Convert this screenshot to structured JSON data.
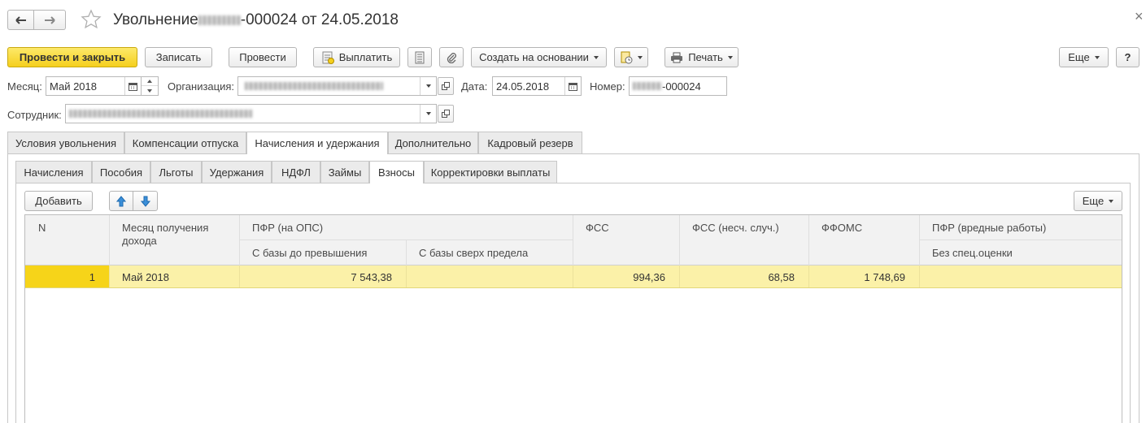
{
  "window": {
    "title_prefix": "Увольнение ",
    "title_suffix": "-000024 от 24.05.2018",
    "close_glyph": "×"
  },
  "toolbar": {
    "post_close": "Провести и закрыть",
    "save": "Записать",
    "post": "Провести",
    "pay": "Выплатить",
    "create_based": "Создать на основании",
    "print": "Печать",
    "more": "Еще",
    "help": "?"
  },
  "form": {
    "month_label": "Месяц:",
    "month_value": "Май 2018",
    "org_label": "Организация:",
    "date_label": "Дата:",
    "date_value": "24.05.2018",
    "number_label": "Номер:",
    "number_suffix": "-000024",
    "employee_label": "Сотрудник:"
  },
  "tabs_main": [
    "Условия увольнения",
    "Компенсации отпуска",
    "Начисления и удержания",
    "Дополнительно",
    "Кадровый резерв"
  ],
  "tabs_sub": [
    "Начисления",
    "Пособия",
    "Льготы",
    "Удержания",
    "НДФЛ",
    "Займы",
    "Взносы",
    "Корректировки выплаты"
  ],
  "table_toolbar": {
    "add": "Добавить",
    "more": "Еще"
  },
  "table": {
    "headers": {
      "n": "N",
      "month_line1": "Месяц получения",
      "month_line2": "дохода",
      "pfr": "ПФР (на ОПС)",
      "pfr_base": "С базы до превышения",
      "pfr_over": "С базы сверх предела",
      "fss": "ФСС",
      "fss_ns": "ФСС (несч. случ.)",
      "ffoms": "ФФОМС",
      "pfr_harm": "ПФР (вредные работы)",
      "pfr_harm_sub": "Без спец.оценки"
    },
    "rows": [
      {
        "n": "1",
        "month": "Май 2018",
        "pfr_base": "7 543,38",
        "pfr_over": "",
        "fss": "994,36",
        "fss_ns": "68,58",
        "ffoms": "1 748,69",
        "pfr_harm": ""
      }
    ]
  },
  "colors": {
    "accent_yellow": "#f5cf1d",
    "selected_row": "#fbf1a8",
    "selected_cell": "#f6d419"
  }
}
